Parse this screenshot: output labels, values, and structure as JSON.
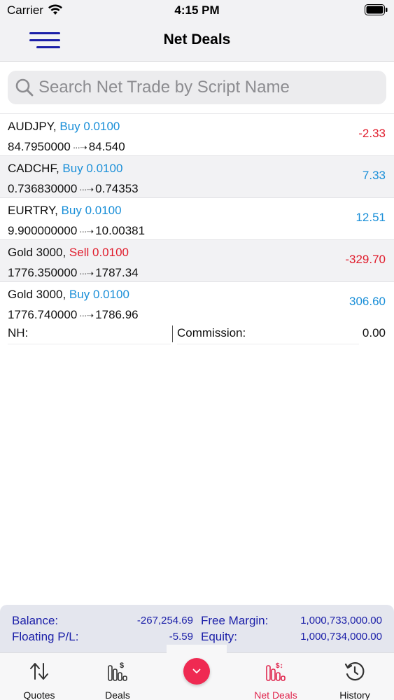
{
  "status_bar": {
    "carrier": "Carrier",
    "time": "4:15 PM"
  },
  "nav": {
    "title": "Net Deals",
    "menu_icon": "hamburger-menu-icon"
  },
  "search": {
    "placeholder": "Search Net Trade by Script Name",
    "value": ""
  },
  "trades": [
    {
      "symbol": "AUDJPY,",
      "side": "Buy 0.0100",
      "side_type": "buy",
      "open_price": "84.7950000",
      "current_price": "84.540",
      "pl": "-2.33",
      "pl_type": "neg"
    },
    {
      "symbol": "CADCHF,",
      "side": "Buy 0.0100",
      "side_type": "buy",
      "open_price": "0.736830000",
      "current_price": "0.74353",
      "pl": "7.33",
      "pl_type": "pos"
    },
    {
      "symbol": "EURTRY,",
      "side": "Buy 0.0100",
      "side_type": "buy",
      "open_price": "9.900000000",
      "current_price": "10.00381",
      "pl": "12.51",
      "pl_type": "pos"
    },
    {
      "symbol": "Gold 3000,",
      "side": "Sell 0.0100",
      "side_type": "sell",
      "open_price": "1776.350000",
      "current_price": "1787.34",
      "pl": "-329.70",
      "pl_type": "neg"
    },
    {
      "symbol": "Gold 3000,",
      "side": "Buy 0.0100",
      "side_type": "buy",
      "open_price": "1776.740000",
      "current_price": "1786.96",
      "pl": "306.60",
      "pl_type": "pos"
    }
  ],
  "expanded": {
    "nh_label": "NH:",
    "commission_label": "Commission:",
    "commission_value": "0.00"
  },
  "summary": {
    "balance_label": "Balance:",
    "balance_value": "-267,254.69",
    "floating_label": "Floating P/L:",
    "floating_value": "-5.59",
    "free_margin_label": "Free Margin:",
    "free_margin_value": "1,000,733,000.00",
    "equity_label": "Equity:",
    "equity_value": "1,000,734,000.00"
  },
  "tabs": [
    {
      "label": "Quotes",
      "icon": "quotes-arrows-icon"
    },
    {
      "label": "Deals",
      "icon": "deals-bars-icon"
    },
    {
      "label": "Net Deals",
      "icon": "net-deals-bars-icon",
      "active": true
    },
    {
      "label": "History",
      "icon": "history-clock-icon"
    }
  ],
  "colors": {
    "buy": "#1a8fd8",
    "sell": "#e01c2c",
    "summary_text": "#1a1ea8",
    "active_tab": "#e0264e",
    "center_button": "#ef2a52"
  }
}
